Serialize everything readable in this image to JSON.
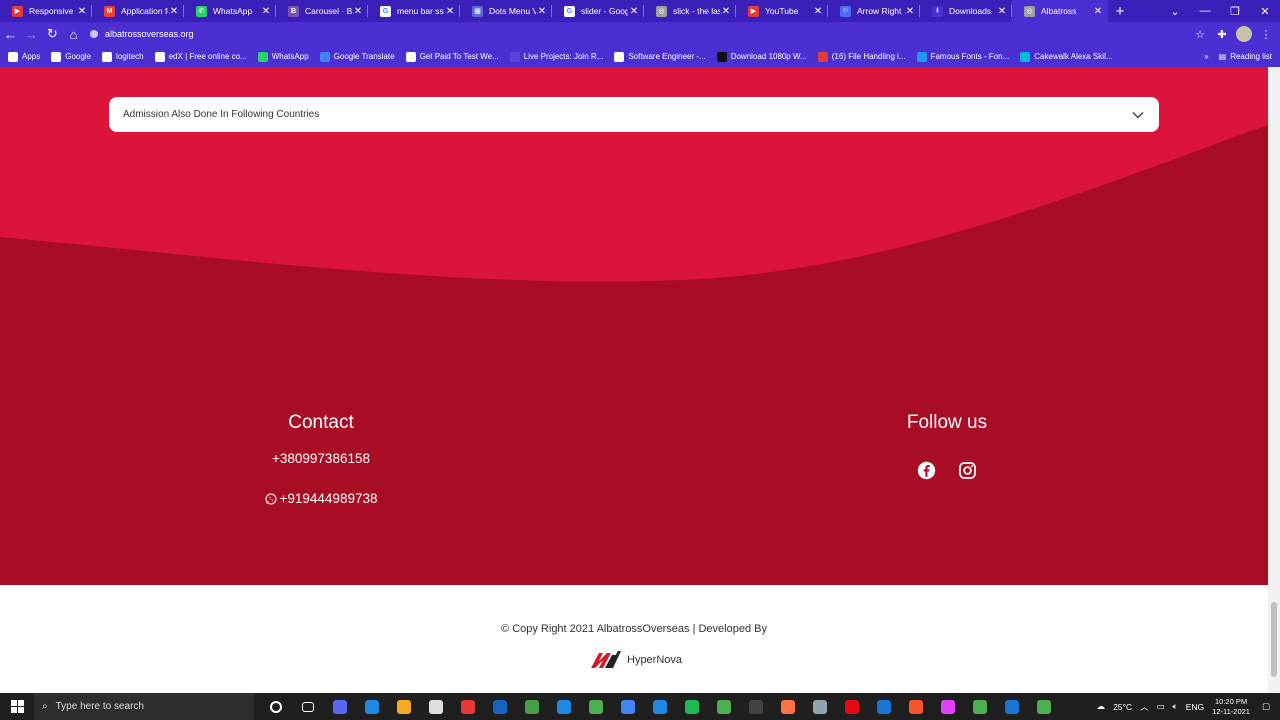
{
  "browser": {
    "tabs": [
      {
        "label": "Responsive Sl",
        "color": "#e53935",
        "glyph": "▶"
      },
      {
        "label": "Application fo",
        "color": "#ea4335",
        "glyph": "M"
      },
      {
        "label": "WhatsApp",
        "color": "#25d366",
        "glyph": "✆"
      },
      {
        "label": "Carousel · Bo",
        "color": "#7952b3",
        "glyph": "B"
      },
      {
        "label": "menu bar ssv",
        "color": "#ffffff",
        "glyph": "G"
      },
      {
        "label": "Dots Menu Ve",
        "color": "#5b6bd8",
        "glyph": "▦"
      },
      {
        "label": "slider - Goog",
        "color": "#ffffff",
        "glyph": "G"
      },
      {
        "label": "slick - the las",
        "color": "#9e9e9e",
        "glyph": "◎"
      },
      {
        "label": "YouTube",
        "color": "#e53935",
        "glyph": "▶"
      },
      {
        "label": "Arrow Right I",
        "color": "#4a6cf7",
        "glyph": "⚐"
      },
      {
        "label": "Downloads",
        "color": "#4b2fd2",
        "glyph": "⭳"
      },
      {
        "label": "Albatross",
        "color": "#9e9e9e",
        "glyph": "◎"
      }
    ],
    "url": "albatrossoverseas.org",
    "bookmarks": [
      {
        "label": "Apps",
        "color": "#ffffff"
      },
      {
        "label": "Google",
        "color": "#ffffff"
      },
      {
        "label": "logitech",
        "color": "#ffffff"
      },
      {
        "label": "edX | Free online co...",
        "color": "#ffffff"
      },
      {
        "label": "WhatsApp",
        "color": "#25d366"
      },
      {
        "label": "Google Translate",
        "color": "#4285f4"
      },
      {
        "label": "Get Paid To Test We...",
        "color": "#ffffff"
      },
      {
        "label": "Live Projects: Join R...",
        "color": "#5b45d9"
      },
      {
        "label": "Software Engineer -...",
        "color": "#ffffff"
      },
      {
        "label": "Download 1080p W...",
        "color": "#111111"
      },
      {
        "label": "(16) File Handling i...",
        "color": "#e53935"
      },
      {
        "label": "Famous Fonts - Fon...",
        "color": "#2196f3"
      },
      {
        "label": "Cakewalk Alexa Skil...",
        "color": "#00bcd4"
      }
    ],
    "reading_list": "Reading list"
  },
  "page": {
    "accordion_label": "Admission Also Done In Following Countries",
    "contact": {
      "title": "Contact",
      "phone": "+380997386158",
      "whatsapp": "+919444989738"
    },
    "follow": {
      "title": "Follow us"
    },
    "footer": {
      "copyright": "© Copy Right 2021 AlbatrossOverseas  | Developed By",
      "brand": "HyperNova"
    },
    "colors": {
      "wave_light": "#dc143c",
      "wave_dark": "#a90d25"
    }
  },
  "taskbar": {
    "search_placeholder": "Type here to search",
    "apps": [
      "#5865f2",
      "#1e88e5",
      "#f9a825",
      "#e0e0e0",
      "#e53935",
      "#1565c0",
      "#43a047",
      "#1e88e5",
      "#4caf50",
      "#4285f4",
      "#1e88e5",
      "#1db954",
      "#4caf50",
      "#424242",
      "#ff7043",
      "#90a4ae",
      "#e50914",
      "#1976d2",
      "#fb542b",
      "#e040fb",
      "#4caf50",
      "#1976d2",
      "#4caf50"
    ],
    "weather": "25°C",
    "lang": "ENG",
    "time": "10:20 PM",
    "date": "12-11-2021"
  }
}
